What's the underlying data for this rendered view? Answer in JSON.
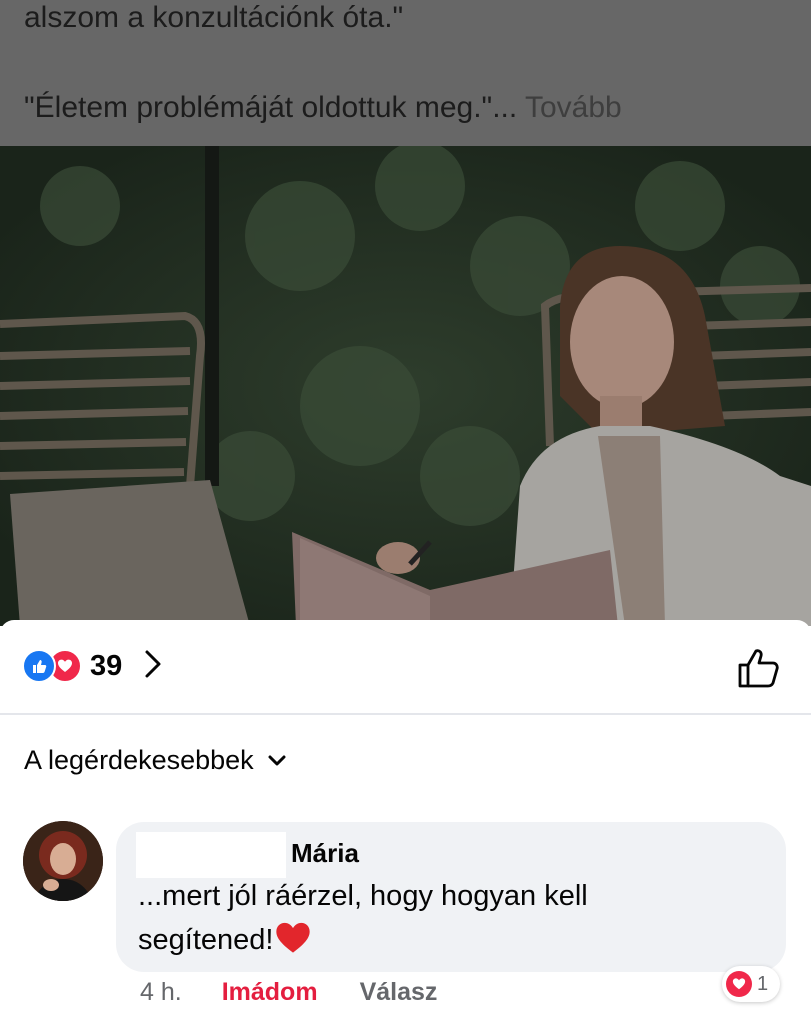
{
  "post": {
    "line1": "alszom a konzultációnk óta.\"",
    "line2": "\"Életem problémáját oldottuk meg.\"...",
    "more_label": "Tovább"
  },
  "reactions": {
    "types": [
      "like-icon",
      "love-icon"
    ],
    "count": "39"
  },
  "sort": {
    "label": "A legérdekesebbek"
  },
  "comment": {
    "author": "Mária",
    "text_line1": "...mert jól ráérzel, hogy hogyan kell",
    "text_line2": "segítened!",
    "time": "4 h.",
    "love_label": "Imádom",
    "reply_label": "Válasz",
    "reaction_count": "1"
  },
  "colors": {
    "facebook_blue": "#1877f2",
    "love_red": "#f0284a",
    "loved_text": "#e41e3f",
    "bubble_bg": "#f0f2f5"
  }
}
